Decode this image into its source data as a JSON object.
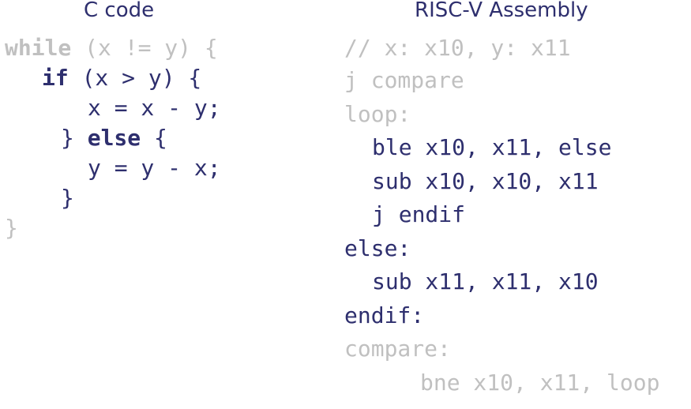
{
  "headers": {
    "c": "C code",
    "asm": "RISC-V Assembly"
  },
  "c_code": {
    "l1_kw": "while",
    "l1_rest": " (x != y) {",
    "l2_kw": "if",
    "l2_rest": " (x > y) {",
    "l3": "x = x - y;",
    "l4_brace": "} ",
    "l4_kw": "else",
    "l4_rest": " {",
    "l5": "y = y - x;",
    "l6": "}",
    "l7": "}"
  },
  "asm_code": {
    "l1": "// x: x10, y: x11",
    "l2": "j compare",
    "l3": "loop:",
    "l4": "ble x10, x11, else",
    "l5": "sub x10, x10, x11",
    "l6": "j endif",
    "l7": "else:",
    "l8": "sub x11, x11, x10",
    "l9": "endif:",
    "l10": "compare:",
    "l11": "bne x10, x11, loop"
  },
  "colors": {
    "highlight": "#2e2f6e",
    "dimmed": "#c0c0c0"
  }
}
